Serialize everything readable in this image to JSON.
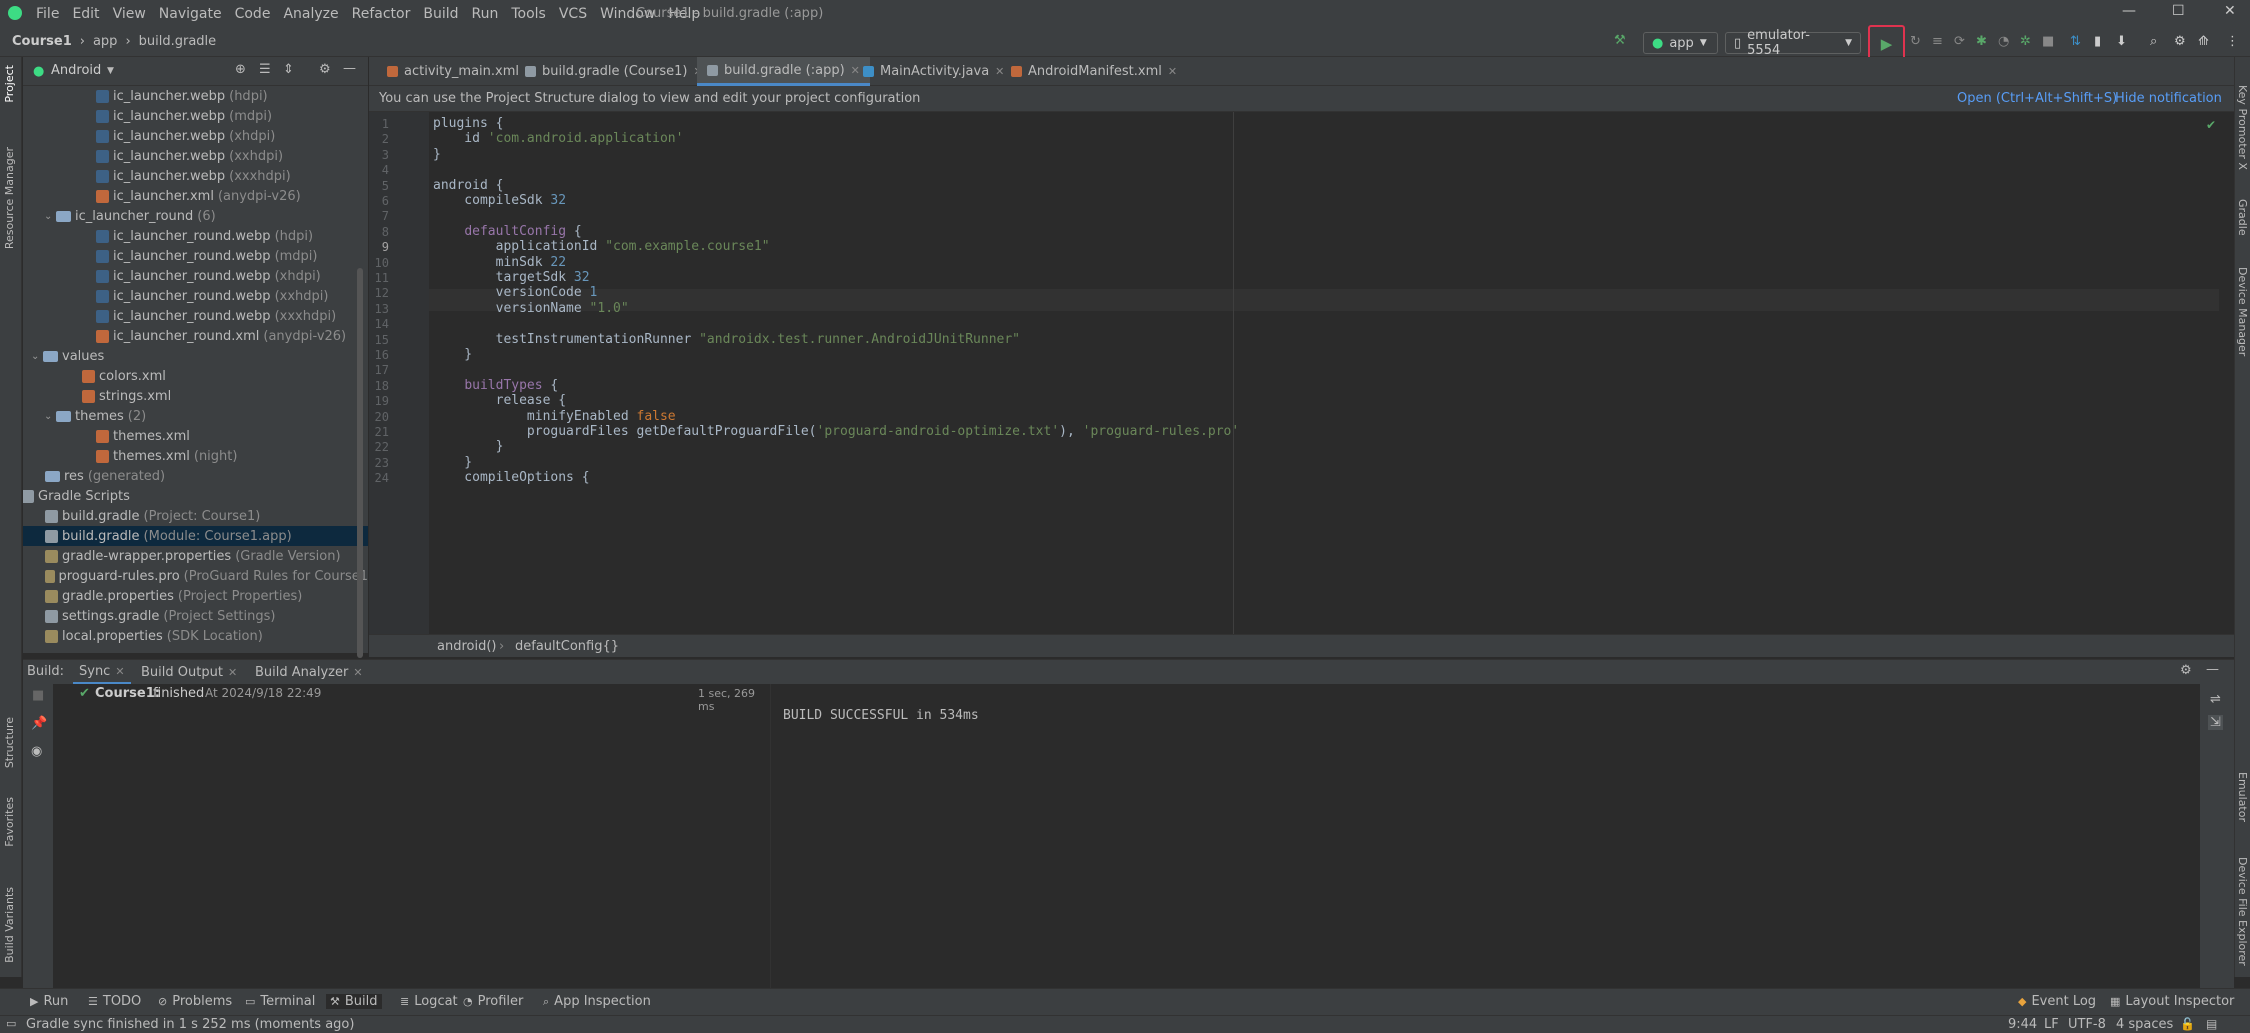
{
  "window": {
    "menu": [
      "File",
      "Edit",
      "View",
      "Navigate",
      "Code",
      "Analyze",
      "Refactor",
      "Build",
      "Run",
      "Tools",
      "VCS",
      "Window",
      "Help"
    ],
    "title": "Course1 - build.gradle (:app)"
  },
  "nav": {
    "crumbs": [
      "Course1",
      "app",
      "build.gradle"
    ],
    "config": "app",
    "device": "emulator-5554"
  },
  "project": {
    "view": "Android",
    "tree": [
      {
        "indent": 96,
        "icon": "ic-img",
        "label": "ic_launcher.webp",
        "hint": "(hdpi)"
      },
      {
        "indent": 96,
        "icon": "ic-img",
        "label": "ic_launcher.webp",
        "hint": "(mdpi)"
      },
      {
        "indent": 96,
        "icon": "ic-img",
        "label": "ic_launcher.webp",
        "hint": "(xhdpi)"
      },
      {
        "indent": 96,
        "icon": "ic-img",
        "label": "ic_launcher.webp",
        "hint": "(xxhdpi)"
      },
      {
        "indent": 96,
        "icon": "ic-img",
        "label": "ic_launcher.webp",
        "hint": "(xxxhdpi)"
      },
      {
        "indent": 96,
        "icon": "ic-xml",
        "label": "ic_launcher.xml",
        "hint": "(anydpi-v26)"
      },
      {
        "indent": 58,
        "chev": "⌄",
        "icon": "ic-folder",
        "label": "ic_launcher_round",
        "hint": "(6)"
      },
      {
        "indent": 96,
        "icon": "ic-img",
        "label": "ic_launcher_round.webp",
        "hint": "(hdpi)"
      },
      {
        "indent": 96,
        "icon": "ic-img",
        "label": "ic_launcher_round.webp",
        "hint": "(mdpi)"
      },
      {
        "indent": 96,
        "icon": "ic-img",
        "label": "ic_launcher_round.webp",
        "hint": "(xhdpi)"
      },
      {
        "indent": 96,
        "icon": "ic-img",
        "label": "ic_launcher_round.webp",
        "hint": "(xxhdpi)"
      },
      {
        "indent": 96,
        "icon": "ic-img",
        "label": "ic_launcher_round.webp",
        "hint": "(xxxhdpi)"
      },
      {
        "indent": 96,
        "icon": "ic-xml",
        "label": "ic_launcher_round.xml",
        "hint": "(anydpi-v26)"
      },
      {
        "indent": 45,
        "chev": "⌄",
        "icon": "ic-folder",
        "label": "values",
        "hint": ""
      },
      {
        "indent": 82,
        "icon": "ic-xml",
        "label": "colors.xml",
        "hint": ""
      },
      {
        "indent": 82,
        "icon": "ic-xml",
        "label": "strings.xml",
        "hint": ""
      },
      {
        "indent": 58,
        "chev": "⌄",
        "icon": "ic-folder",
        "label": "themes",
        "hint": "(2)"
      },
      {
        "indent": 96,
        "icon": "ic-xml",
        "label": "themes.xml",
        "hint": ""
      },
      {
        "indent": 96,
        "icon": "ic-xml",
        "label": "themes.xml",
        "hint": "(night)"
      },
      {
        "indent": 45,
        "icon": "ic-folder",
        "label": "res",
        "hint": "(generated)"
      },
      {
        "indent": 20,
        "chev": "⌄",
        "icon": "ic-gradle",
        "label": "Gradle Scripts",
        "hint": ""
      },
      {
        "indent": 45,
        "icon": "ic-gradle",
        "label": "build.gradle",
        "hint": "(Project: Course1)"
      },
      {
        "indent": 45,
        "icon": "ic-gradle",
        "label": "build.gradle",
        "hint": "(Module: Course1.app)",
        "sel": true
      },
      {
        "indent": 45,
        "icon": "ic-props",
        "label": "gradle-wrapper.properties",
        "hint": "(Gradle Version)"
      },
      {
        "indent": 45,
        "icon": "ic-props",
        "label": "proguard-rules.pro",
        "hint": "(ProGuard Rules for Course1"
      },
      {
        "indent": 45,
        "icon": "ic-props",
        "label": "gradle.properties",
        "hint": "(Project Properties)"
      },
      {
        "indent": 45,
        "icon": "ic-gradle",
        "label": "settings.gradle",
        "hint": "(Project Settings)"
      },
      {
        "indent": 45,
        "icon": "ic-props",
        "label": "local.properties",
        "hint": "(SDK Location)"
      }
    ]
  },
  "tabs": [
    {
      "label": "activity_main.xml",
      "color": "#c0683c"
    },
    {
      "label": "build.gradle (Course1)",
      "color": "#8f9aa3"
    },
    {
      "label": "build.gradle (:app)",
      "color": "#8f9aa3",
      "active": true
    },
    {
      "label": "MainActivity.java",
      "color": "#3d8fc7"
    },
    {
      "label": "AndroidManifest.xml",
      "color": "#c0683c"
    }
  ],
  "notice": {
    "text": "You can use the Project Structure dialog to view and edit your project configuration",
    "open": "Open (Ctrl+Alt+Shift+S)",
    "hide": "Hide notification"
  },
  "code": [
    [
      [
        "",
        "plugins {"
      ]
    ],
    [
      [
        "",
        "    id "
      ],
      [
        "str",
        "'com.android.application'"
      ]
    ],
    [
      [
        "",
        "}"
      ]
    ],
    [
      [
        "",
        ""
      ]
    ],
    [
      [
        "",
        "android {"
      ]
    ],
    [
      [
        "",
        "    compileSdk "
      ],
      [
        "num",
        "32"
      ]
    ],
    [
      [
        "",
        ""
      ]
    ],
    [
      [
        "",
        "    "
      ],
      [
        "fn",
        "defaultConfig"
      ],
      [
        "",
        " {"
      ]
    ],
    [
      [
        "",
        "        applicationId "
      ],
      [
        "str",
        "\"com.example.course1\""
      ]
    ],
    [
      [
        "",
        "        minSdk "
      ],
      [
        "num",
        "22"
      ]
    ],
    [
      [
        "",
        "        targetSdk "
      ],
      [
        "num",
        "32"
      ]
    ],
    [
      [
        "",
        "        versionCode "
      ],
      [
        "num",
        "1"
      ]
    ],
    [
      [
        "",
        "        versionName "
      ],
      [
        "str",
        "\"1.0\""
      ]
    ],
    [
      [
        "",
        ""
      ]
    ],
    [
      [
        "",
        "        testInstrumentationRunner "
      ],
      [
        "str",
        "\"androidx.test.runner.AndroidJUnitRunner\""
      ]
    ],
    [
      [
        "",
        "    }"
      ]
    ],
    [
      [
        "",
        ""
      ]
    ],
    [
      [
        "",
        "    "
      ],
      [
        "fn",
        "buildTypes"
      ],
      [
        "",
        " {"
      ]
    ],
    [
      [
        "",
        "        release {"
      ]
    ],
    [
      [
        "",
        "            minifyEnabled "
      ],
      [
        "kw",
        "false"
      ]
    ],
    [
      [
        "",
        "            proguardFiles getDefaultProguardFile("
      ],
      [
        "str",
        "'proguard-android-optimize.txt'"
      ],
      [
        "",
        "), "
      ],
      [
        "str",
        "'proguard-rules.pro'"
      ]
    ],
    [
      [
        "",
        "        }"
      ]
    ],
    [
      [
        "",
        "    }"
      ]
    ],
    [
      [
        "",
        "    compileOptions {"
      ]
    ]
  ],
  "editor_breadcrumb": [
    "android()",
    "defaultConfig{}"
  ],
  "build": {
    "label": "Build:",
    "tabs": [
      "Sync",
      "Build Output",
      "Build Analyzer"
    ],
    "task": "Course1:",
    "status": "finished",
    "time": "At 2024/9/18 22:49",
    "duration": "1 sec, 269 ms",
    "output": "BUILD SUCCESSFUL in 534ms"
  },
  "left_tabs": [
    "Project",
    "Resource Manager",
    "Structure",
    "Favorites",
    "Build Variants"
  ],
  "right_tabs": [
    "Key Promoter X",
    "Gradle",
    "Device Manager",
    "Emulator",
    "Device File Explorer"
  ],
  "tools": [
    "Run",
    "TODO",
    "Problems",
    "Terminal",
    "Build",
    "Logcat",
    "Profiler",
    "App Inspection"
  ],
  "tools_right": [
    "Event Log",
    "Layout Inspector"
  ],
  "status": {
    "message": "Gradle sync finished in 1 s 252 ms (moments ago)",
    "pos": "9:44",
    "sep": "LF",
    "enc": "UTF-8",
    "indent": "4 spaces"
  }
}
